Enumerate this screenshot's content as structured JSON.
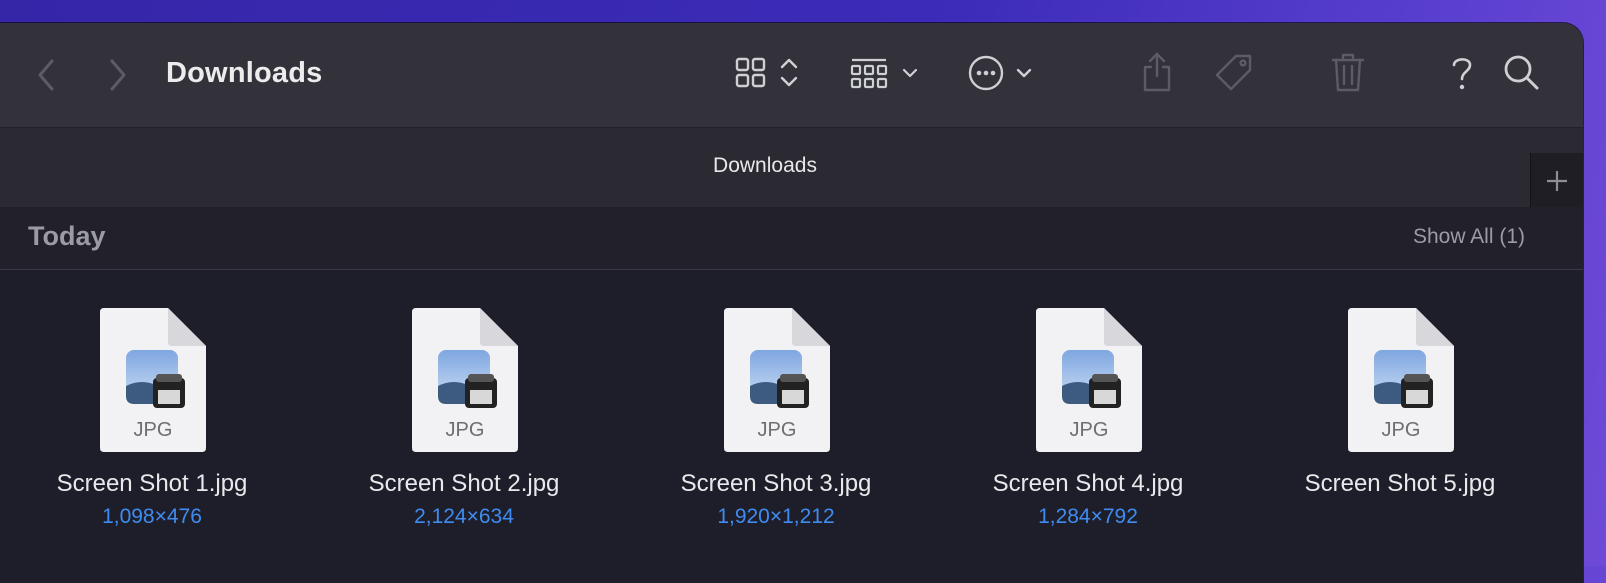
{
  "window": {
    "title": "Downloads",
    "tab_label": "Downloads"
  },
  "toolbar": {
    "back_icon": "chevron-left-icon",
    "forward_icon": "chevron-right-icon",
    "view_icon": "icon-grid-view-icon",
    "group_icon": "group-by-icon",
    "action_icon": "ellipsis-circle-icon",
    "share_icon": "share-icon",
    "tag_icon": "tag-icon",
    "trash_icon": "trash-icon",
    "help_icon": "question-mark-icon",
    "search_icon": "search-icon"
  },
  "section": {
    "title": "Today",
    "show_all": "Show All (1)"
  },
  "files": [
    {
      "name": "Screen Shot 1.jpg",
      "dims": "1,098×476",
      "type": "JPG"
    },
    {
      "name": "Screen Shot 2.jpg",
      "dims": "2,124×634",
      "type": "JPG"
    },
    {
      "name": "Screen Shot 3.jpg",
      "dims": "1,920×1,212",
      "type": "JPG"
    },
    {
      "name": "Screen Shot 4.jpg",
      "dims": "1,284×792",
      "type": "JPG"
    },
    {
      "name": "Screen Shot 5.jpg",
      "dims": "",
      "type": "JPG"
    }
  ],
  "colors": {
    "accent": "#3f8cf0",
    "toolbar_bg": "#33323b",
    "content_bg": "#1e1e2a",
    "desktop": "#3526a8"
  }
}
